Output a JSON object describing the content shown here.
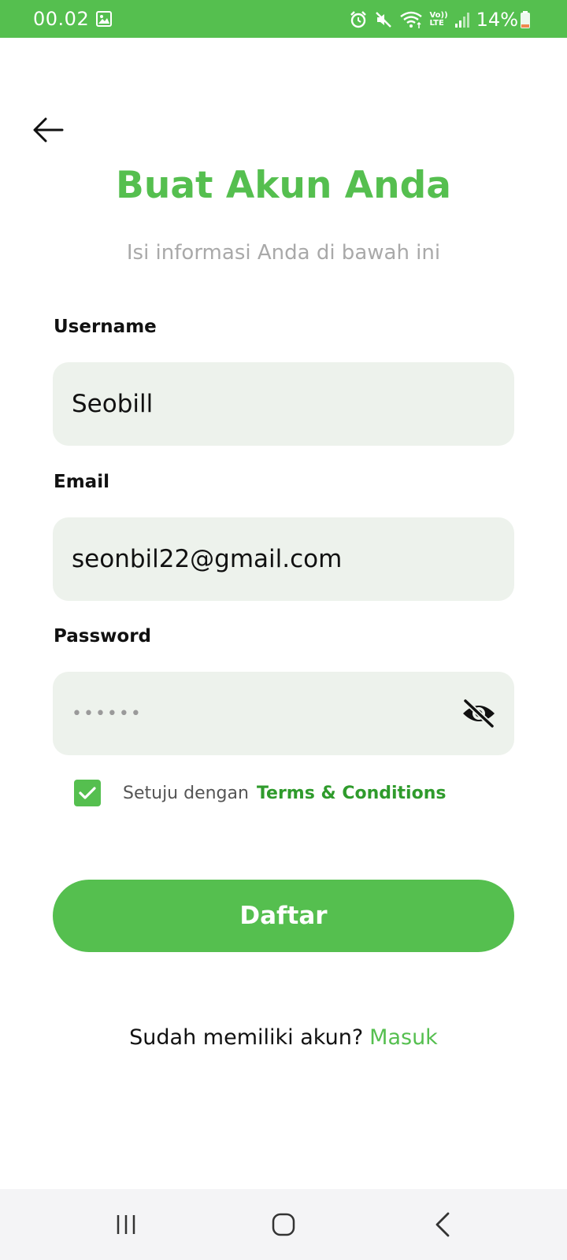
{
  "status_bar": {
    "time": "00.02",
    "battery_text": "14%",
    "icons": [
      "gallery-icon",
      "alarm-icon",
      "mute-icon",
      "wifi-icon",
      "volte-icon",
      "signal-icon",
      "battery-icon"
    ],
    "volte_text_top": "Vo))",
    "volte_text_bottom": "LTE"
  },
  "header": {
    "back_icon": "arrow-left-icon",
    "title": "Buat Akun Anda",
    "subtitle": "Isi informasi Anda di bawah ini"
  },
  "form": {
    "username": {
      "label": "Username",
      "value": "Seobill"
    },
    "email": {
      "label": "Email",
      "value": "seonbil22@gmail.com"
    },
    "password": {
      "label": "Password",
      "masked_value": "••••••",
      "toggle_icon": "eye-off-icon"
    },
    "terms": {
      "checked": true,
      "text": "Setuju dengan",
      "link": "Terms & Conditions"
    },
    "submit_label": "Daftar"
  },
  "footer": {
    "prompt": "Sudah memiliki akun?",
    "link": "Masuk"
  },
  "nav_bar": {
    "icons": [
      "recent-apps-icon",
      "home-icon",
      "back-icon"
    ]
  },
  "colors": {
    "primary": "#55bf4f",
    "terms_link": "#2f9b2c",
    "field_bg": "#edf2ec",
    "subtitle": "#a9a9a9"
  }
}
